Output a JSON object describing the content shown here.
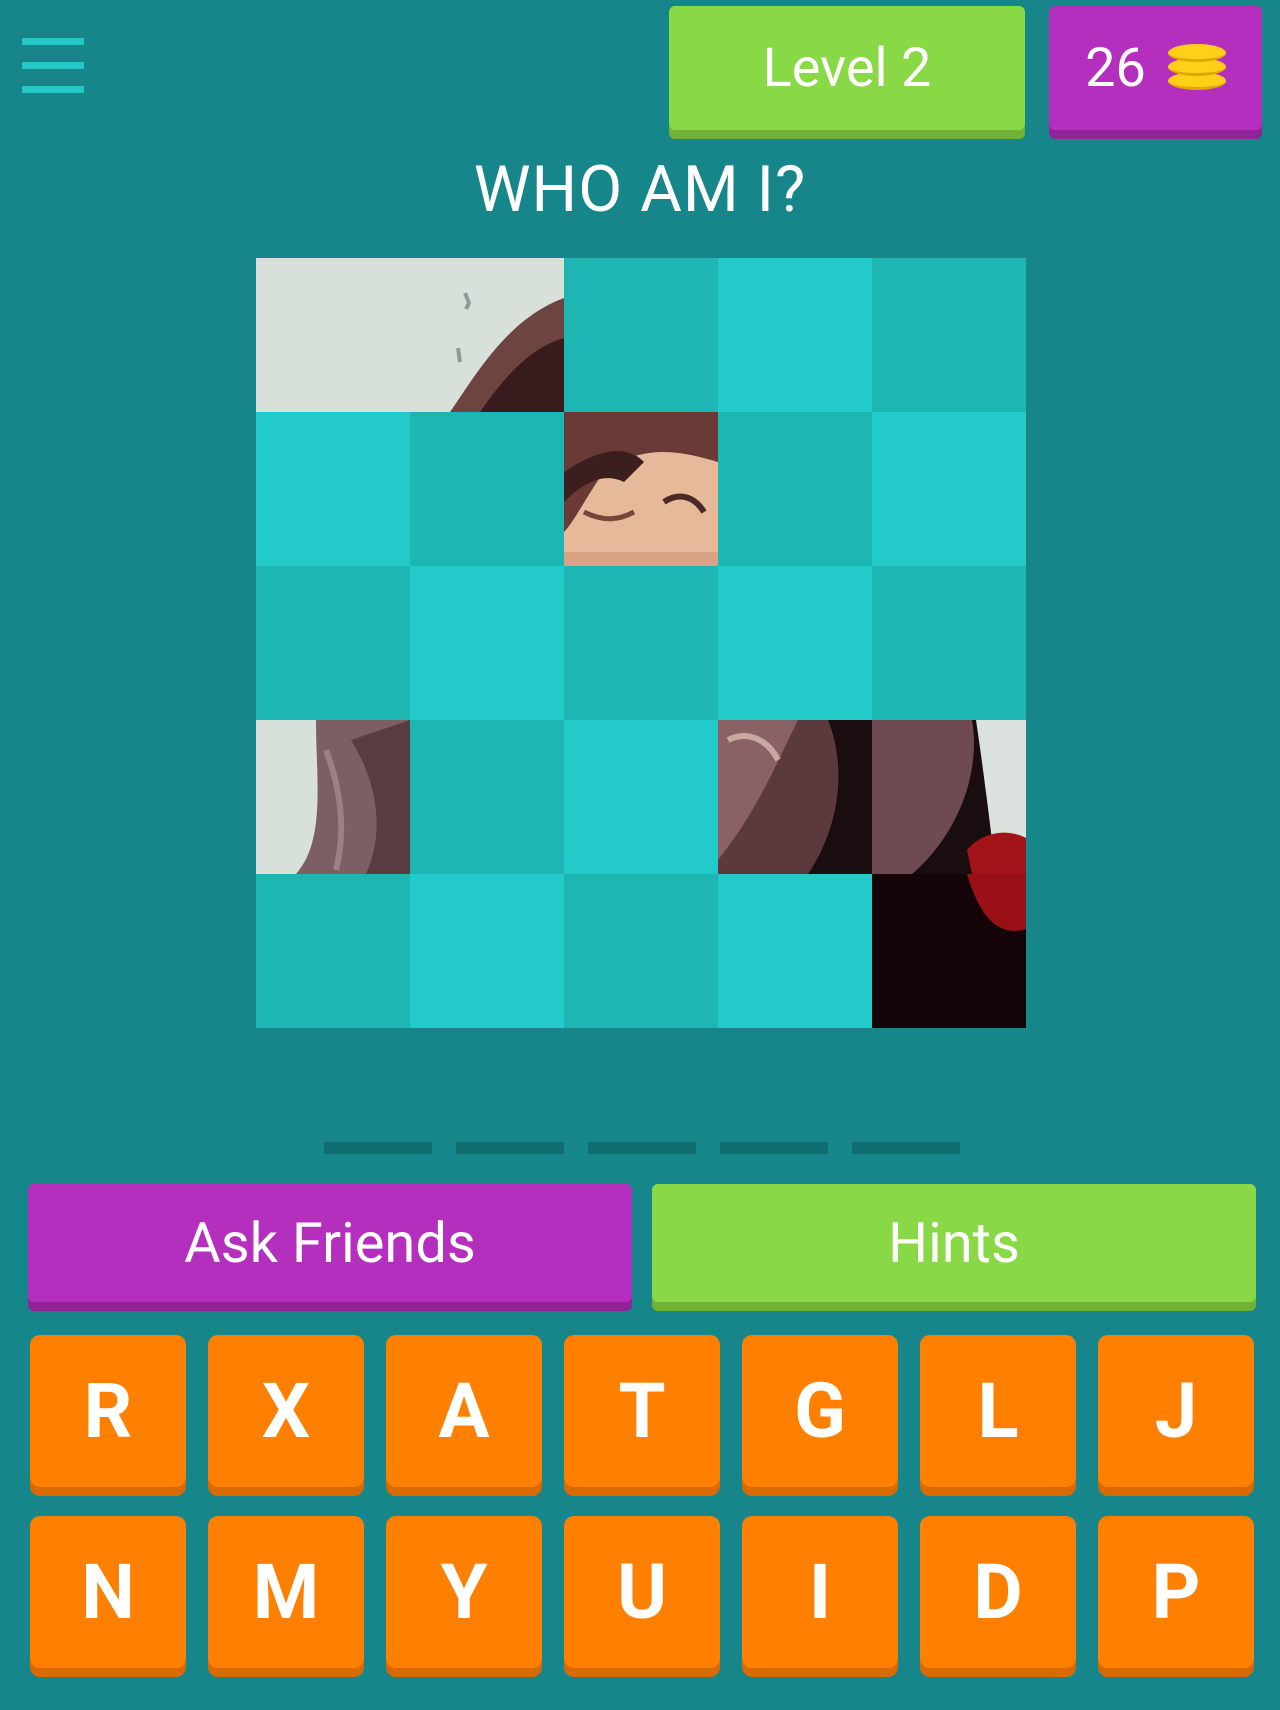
{
  "header": {
    "menu_icon": "hamburger-menu-icon",
    "level_label": "Level 2",
    "coins": "26",
    "coin_icon": "coin-stack-icon"
  },
  "title": "WHO AM I?",
  "puzzle": {
    "rows": 5,
    "cols": 5,
    "revealed_tiles": [
      {
        "row": 0,
        "col": 0,
        "span_cols": 2
      },
      {
        "row": 1,
        "col": 2
      },
      {
        "row": 3,
        "col": 0
      },
      {
        "row": 3,
        "col": 3,
        "span_cols": 2
      },
      {
        "row": 4,
        "col": 4
      }
    ],
    "colors": {
      "cover_light": "#22cbca",
      "cover_dark": "#1db6b3"
    }
  },
  "answer_slots": 5,
  "buttons": {
    "ask_friends": "Ask Friends",
    "hints": "Hints"
  },
  "keyboard": {
    "rows": [
      [
        "R",
        "X",
        "A",
        "T",
        "G",
        "L",
        "J"
      ],
      [
        "N",
        "M",
        "Y",
        "U",
        "I",
        "D",
        "P"
      ]
    ]
  },
  "colors": {
    "background": "#16868a",
    "green": "#89d845",
    "purple": "#b52fbf",
    "orange": "#ff7f00"
  }
}
